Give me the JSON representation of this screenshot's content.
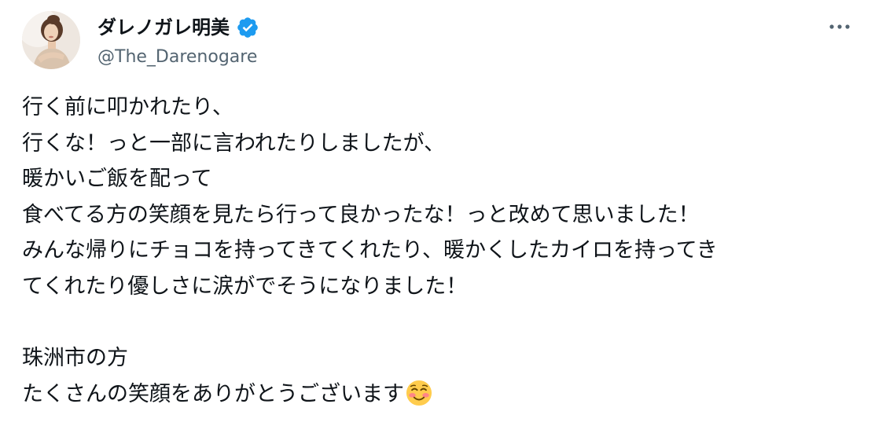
{
  "author": {
    "display_name": "ダレノガレ明美",
    "handle": "@The_Darenogare",
    "verified": true,
    "avatar_icon": "profile-photo",
    "verified_icon": "verified-badge-icon",
    "more_icon": "more-options-icon"
  },
  "tweet": {
    "lines": [
      "行く前に叩かれたり、",
      "行くな！っと一部に言われたりしましたが、",
      "暖かいご飯を配って",
      "食べてる方の笑顔を見たら行って良かったな！っと改めて思いました！",
      "みんな帰りにチョコを持ってきてくれたり、暖かくしたカイロを持ってき",
      "てくれたり優しさに涙がでそうになりました！",
      "",
      "珠洲市の方",
      "たくさんの笑顔をありがとうございます"
    ],
    "trailing_emoji": "smiling-face-blushing-icon"
  },
  "colors": {
    "text": "#0f1419",
    "secondary": "#536471",
    "verified_blue": "#1d9bf0"
  }
}
